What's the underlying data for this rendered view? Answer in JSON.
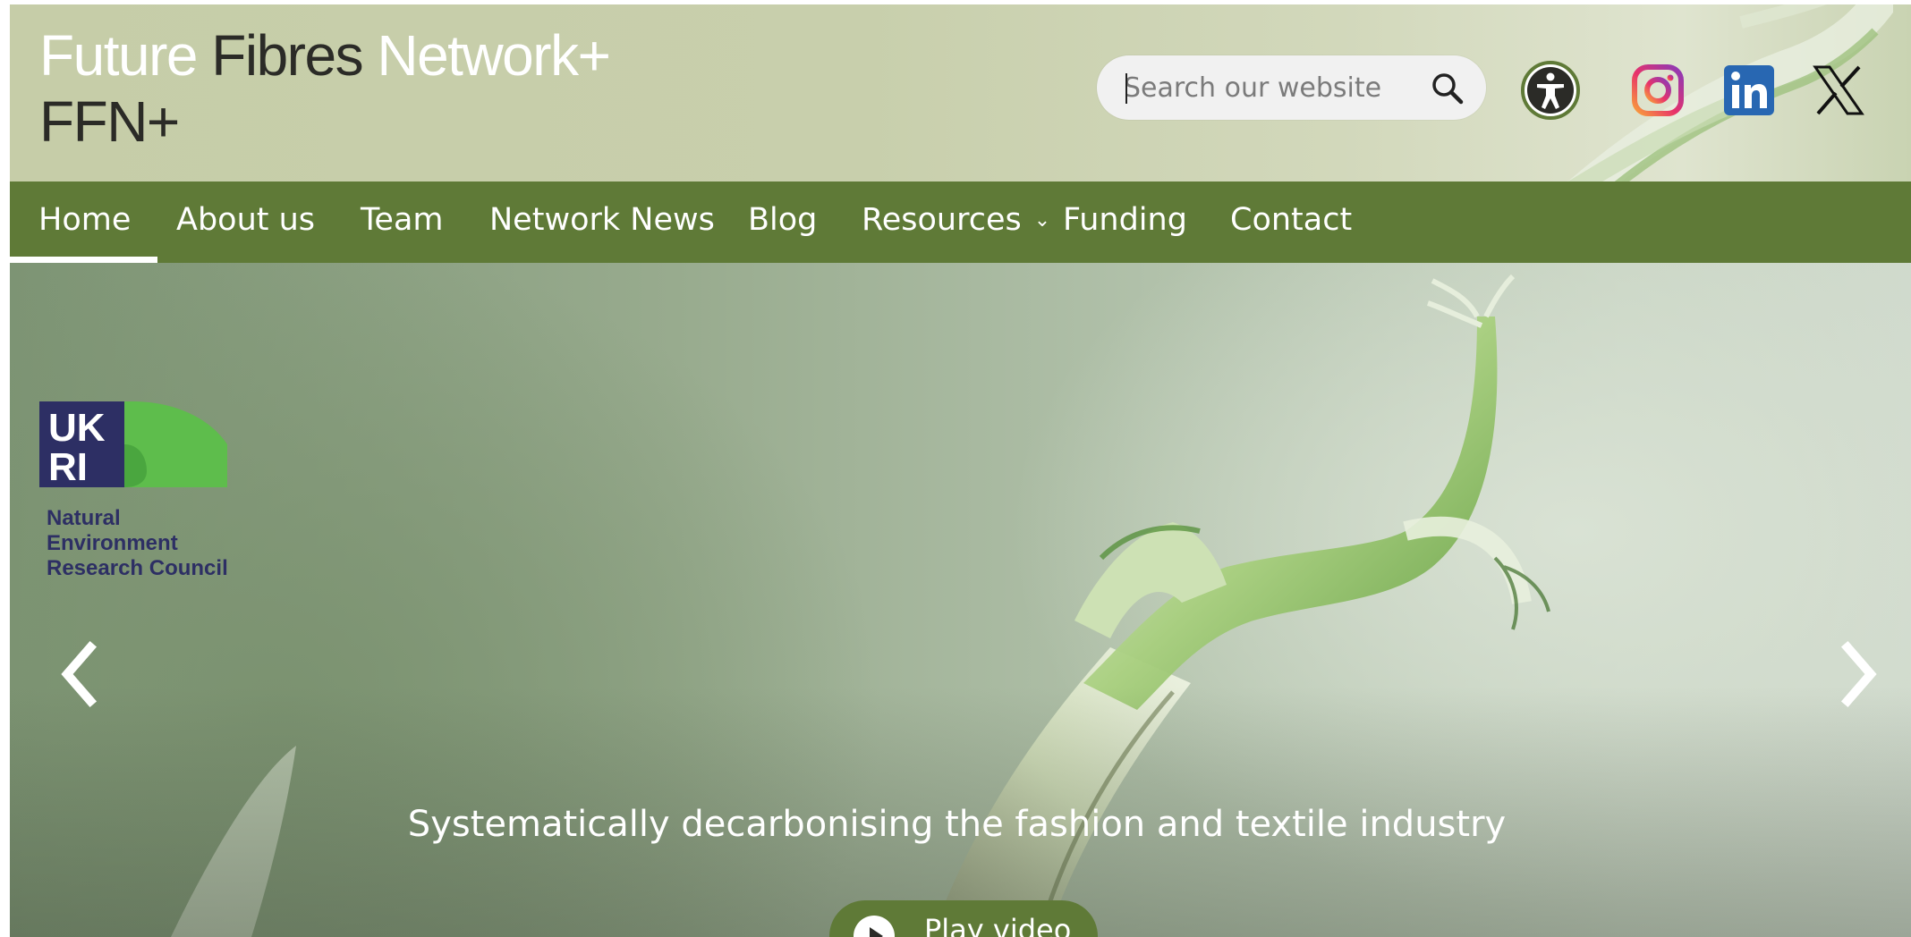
{
  "header": {
    "brand_word1": "Future",
    "brand_word2": "Fibres",
    "brand_word3": "Network+",
    "brand_line2": "FFN+",
    "search_placeholder": "Search our website"
  },
  "icons": {
    "search": "search-icon",
    "accessibility": "accessibility-icon",
    "instagram": "instagram-icon",
    "linkedin": "linkedin-icon",
    "x": "x-icon"
  },
  "nav": {
    "items": [
      {
        "label": "Home",
        "active": true
      },
      {
        "label": "About us"
      },
      {
        "label": "Team"
      },
      {
        "label": "Network News"
      },
      {
        "label": "Blog"
      },
      {
        "label": "Resources",
        "has_dropdown": true
      },
      {
        "label": "Funding"
      },
      {
        "label": "Contact"
      }
    ]
  },
  "hero": {
    "logo_lines": [
      "Natural",
      "Environment",
      "Research Council"
    ],
    "tagline": "Systematically decarbonising the fashion and textile industry",
    "play_label": "Play video"
  },
  "colors": {
    "nav_green": "#5f7a37",
    "header_sage": "#c6cda8",
    "ukri_navy": "#2d2f64",
    "ukri_green": "#5ebd4c"
  }
}
